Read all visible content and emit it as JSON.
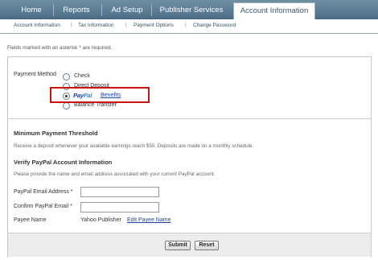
{
  "nav": {
    "tabs": [
      {
        "label": "Home"
      },
      {
        "label": "Reports"
      },
      {
        "label": "Ad Setup"
      },
      {
        "label": "Publisher Services"
      },
      {
        "label": "Account Information"
      }
    ],
    "active_tab": "Account Information"
  },
  "subnav": {
    "items": [
      {
        "label": "Account Information"
      },
      {
        "label": "Tax Information"
      },
      {
        "label": "Payment Options"
      },
      {
        "label": "Change Password"
      }
    ],
    "separator": "|"
  },
  "form": {
    "required_note_before": "Fields marked with an asterisk",
    "required_mark": "*",
    "required_note_after": "are required.",
    "payment_method": {
      "label": "Payment Method",
      "options": [
        {
          "label": "Check",
          "checked": false
        },
        {
          "label": "Direct Deposit",
          "checked": false
        },
        {
          "label": "PayPal",
          "checked": true,
          "logo": true,
          "link": "Benefits"
        },
        {
          "label": "Balance Transfer",
          "checked": false
        }
      ]
    },
    "threshold": {
      "heading": "Minimum Payment Threshold",
      "description": "Receive a deposit whenever your available earnings reach $50. Deposits are made on a monthly schedule."
    },
    "verify": {
      "heading": "Verify PayPal Account Information",
      "description": "Please provide the name and email address associated with your current PayPal account.",
      "email_label": "PayPal Email Address *",
      "email_value": "",
      "confirm_label": "Confirm PayPal Email *",
      "confirm_value": "",
      "payee_label": "Payee Name",
      "payee_value": "Yahoo Publisher",
      "payee_edit_link": "Edit Payee Name"
    },
    "buttons": {
      "submit": "Submit",
      "reset": "Reset"
    }
  },
  "colors": {
    "nav_bg": "#5a7b91",
    "highlight_border": "#cc1111",
    "link": "#1f44a8",
    "paypal_blue_dark": "#1c3d8c",
    "paypal_blue_light": "#2a8ad4"
  }
}
